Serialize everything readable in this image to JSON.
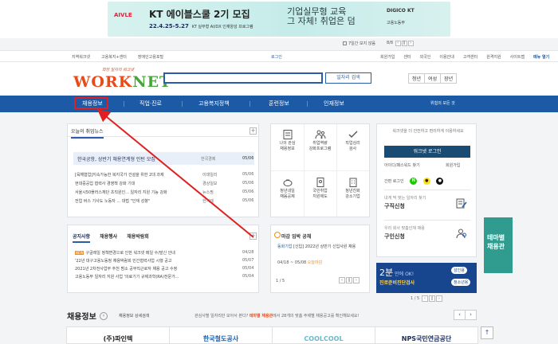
{
  "banner": {
    "brand": "AIVLE",
    "title": "KT 에이블스쿨 2기 모집",
    "date": "22.4.25-5.27",
    "subtitle": "KT 실무형 AI/DX 인재양성 프로그램",
    "center_line1": "기업실무형 교육",
    "center_line2": "그 자체!  취업은 덤",
    "logo_kt": "DIGICO KT",
    "logo_moel": "고용노동부",
    "check_label": "7일간 보지 않음",
    "pager": "8/8"
  },
  "util": {
    "left": [
      "지역워크넷",
      "고용복지+센터",
      "장애인고용포털"
    ],
    "right": [
      "로그인",
      "회원가입",
      "센터",
      "외국인",
      "이용안내",
      "고객센터",
      "원격지원",
      "사이트맵",
      "메뉴 열기"
    ]
  },
  "header": {
    "logo_slogan": "희망 일자리 워크넷",
    "logo_text_a": "WORK",
    "logo_text_b": "NET",
    "search_placeholder": "",
    "search_button": "일자리 검색",
    "user_tabs": [
      "청년",
      "여성",
      "장년"
    ]
  },
  "nav": {
    "items": [
      "채용정보",
      "직업·진로",
      "고용복지정책",
      "훈련정보",
      "인재정보"
    ],
    "right": "위험의 모든 것"
  },
  "news": {
    "tab": "오늘의 취업뉴스",
    "featured": {
      "title": "한국공항, 상반기 채용연계형 인턴 모집",
      "source": "한국경제",
      "date": "05/06"
    },
    "items": [
      {
        "title": "[육해협업]지속가능한 복지국가 건설을 위한 2대 과제",
        "source": "이데일리",
        "date": "05/06"
      },
      {
        "title": "현대중공업 협력사 경영책 강화 기대",
        "source": "경상일보",
        "date": "05/06"
      },
      {
        "title": "서울시50플러스재단 초직원인... 일자리 지원 기능 강화",
        "source": "뉴스핌",
        "date": "05/06"
      },
      {
        "title": "전업 버스 기사도 노동자 ... 대법 \"인재 성향\"",
        "source": "한겨레",
        "date": "05/06"
      }
    ]
  },
  "notice": {
    "tabs": [
      "공지사항",
      "채용행사",
      "채용박람회"
    ],
    "items": [
      {
        "badge": "NEW",
        "title": "구글레일 정책변경으로 인한 워크넷 메일 수/발신 안내",
        "date": "04/28"
      },
      {
        "badge": "",
        "title": "'22년 대구고용노동청 채용박람회 민간협력사업 시행 공고",
        "date": "05/07"
      },
      {
        "badge": "",
        "title": "2021년 2차전사업부 추천 범소 공무직근로자 채용 공고 수정",
        "date": "05/04"
      },
      {
        "badge": "",
        "title": "고용노동부 일자리 지원 사업 '의료기기 규제과학(RA)전문가...",
        "date": "05/04"
      }
    ]
  },
  "services": [
    {
      "label1": "나의 관심",
      "label2": "채용정보"
    },
    {
      "label1": "취업역량",
      "label2": "강화프로그램"
    },
    {
      "label1": "직업심리",
      "label2": "검사"
    },
    {
      "label1": "청년내일",
      "label2": "채움공제"
    },
    {
      "label1": "국민취업",
      "label2": "지원제도"
    },
    {
      "label1": "청년친화",
      "label2": "강소기업"
    }
  ],
  "deadline": {
    "title": "마감 임박 공채",
    "company": "동화기업",
    "body": "[신입] 2022년 상반기 신입사원 채용",
    "date": "04/18 ~ 05/08",
    "rest": "오늘마감",
    "pager": "1 / 5"
  },
  "login": {
    "message": "워크넷을 더 안전하고 편리하게 이용하세요",
    "button": "워크넷 로그인",
    "find": "아이디/패스워드 찾기",
    "join": "회원가입",
    "social_label": "간편 로그인",
    "seek_sub": "내게 딱 맞는 일자리 찾기",
    "seek_main": "구직신청",
    "hire_sub": "우리 회사 맞춤인재 채용",
    "hire_main": "구인신청"
  },
  "promo": {
    "big": "2분",
    "big_sub": "만에 OK!",
    "sub": "진로준비진단검사",
    "pill1": "성인용",
    "pill2": "청소년용",
    "pager": "1 / 5"
  },
  "theme": {
    "line1": "테마별",
    "line2": "채용관"
  },
  "jobs": {
    "title": "채용정보",
    "detail": "채용정보 상세검색",
    "msg_a": "관심사별 일자리만 모아서 본다? ",
    "msg_hl": "테마별 채용관",
    "msg_b": "에서 28개의 맞춤 주제별 채용공고를 확인해보세요!",
    "cards": [
      "(주)파인텍",
      "한국철도공사",
      "COOLCOOL",
      "NPS국민연금공단"
    ]
  }
}
